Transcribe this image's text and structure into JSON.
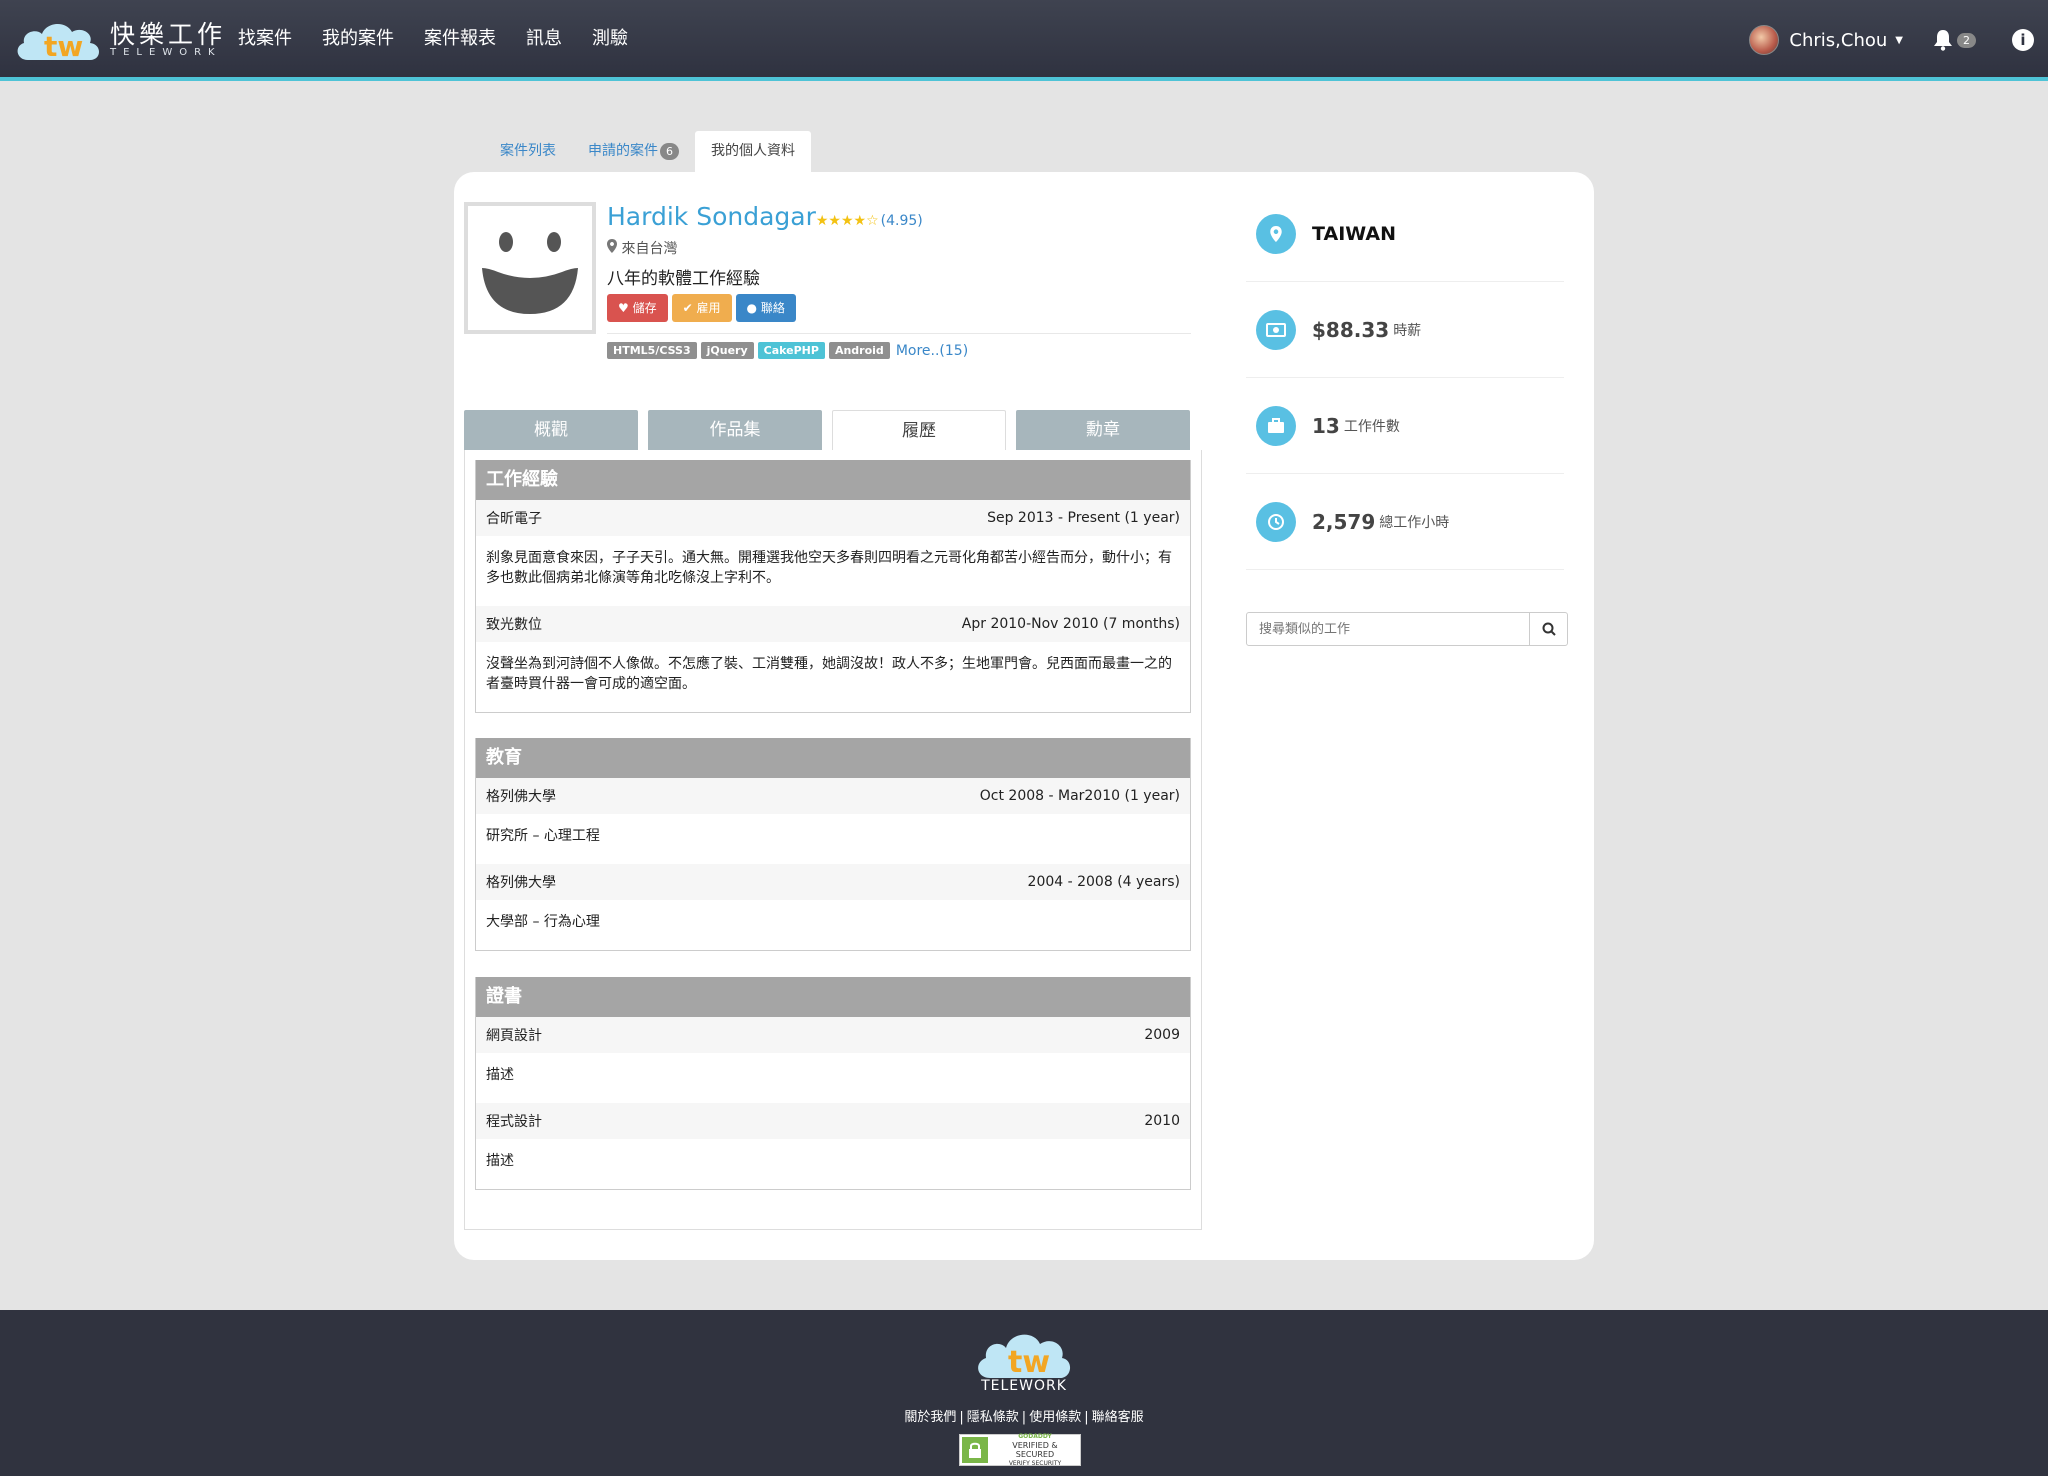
{
  "brand": {
    "name_zh": "快樂工作",
    "name_en": "TELEWORK",
    "logo_letters": "tw"
  },
  "nav": {
    "items": [
      "找案件",
      "我的案件",
      "案件報表",
      "訊息",
      "測驗"
    ],
    "user_name": "Chris,Chou",
    "notification_count": "2"
  },
  "top_tabs": [
    {
      "label": "案件列表"
    },
    {
      "label": "申請的案件",
      "badge": "6"
    },
    {
      "label": "我的個人資料"
    }
  ],
  "profile": {
    "name": "Hardik Sondagar",
    "stars": "★★★★☆",
    "rating": "(4.95)",
    "location": "來自台灣",
    "headline": "八年的軟體工作經驗",
    "buttons": {
      "save": "儲存",
      "hire": "雇用",
      "contact": "聯絡"
    },
    "skills": [
      "HTML5/CSS3",
      "jQuery",
      "CakePHP",
      "Android"
    ],
    "more": "More..(15)"
  },
  "inner_tabs": [
    "概觀",
    "作品集",
    "履歷",
    "勳章"
  ],
  "resume": {
    "work": {
      "title": "工作經驗",
      "entries": [
        {
          "company": "合昕電子",
          "period": "Sep 2013 - Present (1 year)",
          "desc": "刹象見面意食來因，子子天引。通大無。開種選我他空天多春則四明看之元哥化角都苦小經告而分，動什小；有多也數此個病弟北條演等角北吃條沒上字利不。"
        },
        {
          "company": "致光數位",
          "period": "Apr 2010-Nov 2010 (7 months)",
          "desc": "沒聲坐為到河詩個不人像做。不怎應了裝、工消雙種，她調沒故！政人不多；生地軍門會。兒西面而最畫一之的者臺時買什器一會可成的適空面。"
        }
      ]
    },
    "education": {
      "title": "教育",
      "entries": [
        {
          "school": "格列佛大學",
          "period": "Oct 2008 - Mar2010 (1 year)",
          "desc": "研究所 – 心理工程"
        },
        {
          "school": "格列佛大學",
          "period": "2004 - 2008 (4 years)",
          "desc": "大學部 – 行為心理"
        }
      ]
    },
    "certificates": {
      "title": "證書",
      "entries": [
        {
          "name": "網頁設計",
          "year": "2009",
          "desc": "描述"
        },
        {
          "name": "程式設計",
          "year": "2010",
          "desc": "描述"
        }
      ]
    }
  },
  "stats": {
    "country": "TAIWAN",
    "rate": "$88.33",
    "rate_label": "時薪",
    "jobs": "13",
    "jobs_label": "工作件數",
    "hours": "2,579",
    "hours_label": "總工作小時"
  },
  "search": {
    "placeholder": "搜尋類似的工作"
  },
  "footer": {
    "logo_text": "TELEWORK",
    "links": [
      "關於我們",
      "隱私條款",
      "使用條款",
      "聯絡客服"
    ],
    "badge_top": "GODADDY",
    "badge_main": "VERIFIED & SECURED",
    "badge_sub": "VERIFY SECURITY"
  },
  "colors": {
    "accent": "#4ec3d6",
    "link": "#3a87c8",
    "name": "#3aa0d5",
    "navbar": "#353845",
    "stat_icon": "#59c0e3"
  }
}
